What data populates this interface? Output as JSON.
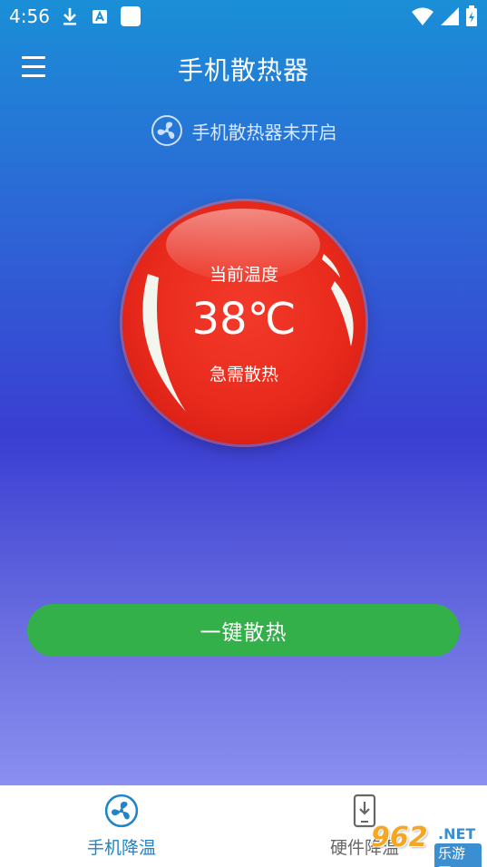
{
  "status_bar": {
    "time": "4:56",
    "icons": [
      "download-icon",
      "a-icon",
      "square-icon",
      "wifi-icon",
      "signal-icon",
      "battery-icon"
    ]
  },
  "app_bar": {
    "title": "手机散热器",
    "menu_icon": "menu-icon"
  },
  "status_line": {
    "icon": "fan-icon",
    "text": "手机散热器未开启"
  },
  "gauge": {
    "label": "当前温度",
    "temperature": "38℃",
    "warning": "急需散热",
    "color": "#e82a1c"
  },
  "action": {
    "label": "一键散热",
    "color": "#34b04a"
  },
  "bottom_nav": {
    "items": [
      {
        "label": "手机降温",
        "icon": "fan-icon",
        "active": true,
        "color": "#1f84c8"
      },
      {
        "label": "硬件降温",
        "icon": "phone-download-icon",
        "active": false
      }
    ]
  },
  "watermark": {
    "number": "962",
    "suffix": ".NET",
    "sub": "乐游网"
  }
}
